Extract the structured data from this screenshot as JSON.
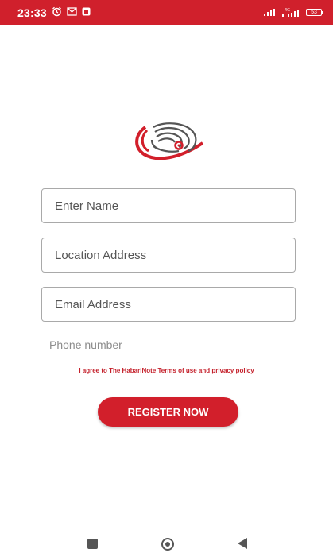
{
  "status_bar": {
    "time": "23:33",
    "icons_left": [
      "alarm-icon",
      "gmail-icon",
      "notification-icon"
    ],
    "icons_right": [
      "signal-icon",
      "signal-4g-icon",
      "battery-icon"
    ],
    "battery": "53",
    "bg_color": "#d0202c"
  },
  "form": {
    "name_placeholder": "Enter Name",
    "location_placeholder": "Location Address",
    "email_placeholder": "Email Address",
    "phone_placeholder": "Phone number",
    "terms_text": "I agree to The HabariNote Terms of use and privacy policy",
    "register_label": "REGISTER NOW"
  },
  "colors": {
    "accent": "#d21f2b",
    "text_muted": "#8d8d8d"
  },
  "nav": {
    "icons": [
      "recents-icon",
      "home-icon",
      "back-icon"
    ]
  }
}
